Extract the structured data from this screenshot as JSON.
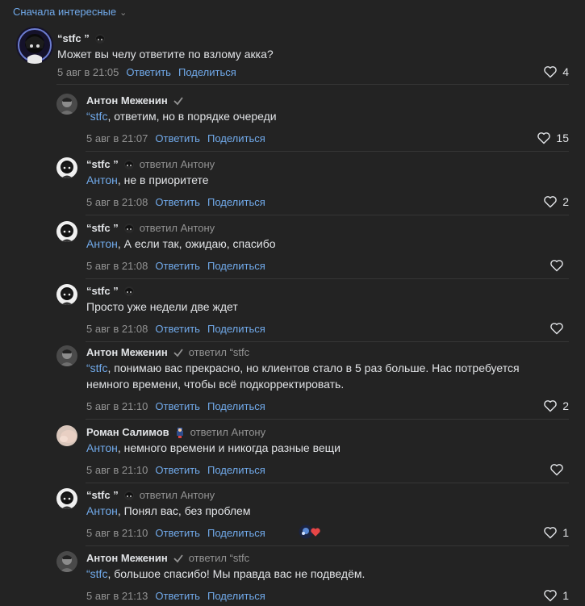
{
  "sort": {
    "label": "Сначала интересные"
  },
  "actions": {
    "reply": "Ответить",
    "share": "Поделиться"
  },
  "comments": [
    {
      "author": "“stfc ”",
      "reply_to": "",
      "mention": "",
      "text": "Может вы челу ответите по взлому акка?",
      "date": "5 авг в 21:05",
      "likes": "4"
    },
    {
      "author": "Антон Меженин",
      "reply_to": "",
      "mention": "“stfc",
      "text": ", ответим, но в порядке очереди",
      "date": "5 авг в 21:07",
      "likes": "15"
    },
    {
      "author": "“stfc ”",
      "reply_to": "ответил Антону",
      "mention": "Антон",
      "text": ", не в приоритете",
      "date": "5 авг в 21:08",
      "likes": "2"
    },
    {
      "author": "“stfc ”",
      "reply_to": "ответил Антону",
      "mention": "Антон",
      "text": ", А если так, ожидаю, спасибо",
      "date": "5 авг в 21:08",
      "likes": ""
    },
    {
      "author": "“stfc ”",
      "reply_to": "",
      "mention": "",
      "text": "Просто уже недели две ждет",
      "date": "5 авг в 21:08",
      "likes": ""
    },
    {
      "author": "Антон Меженин",
      "reply_to": "ответил “stfc",
      "mention": "“stfc",
      "text": ", понимаю вас прекрасно, но клиентов стало в 5 раз больше. Нас потребуется немного времени, чтобы всё подкорректировать.",
      "date": "5 авг в 21:10",
      "likes": "2"
    },
    {
      "author": "Роман Салимов",
      "reply_to": "ответил Антону",
      "mention": "Антон",
      "text": ", немного времени и никогда разные вещи",
      "date": "5 авг в 21:10",
      "likes": ""
    },
    {
      "author": "“stfc ”",
      "reply_to": "ответил Антону",
      "mention": "Антон",
      "text": ", Понял вас, без проблем",
      "date": "5 авг в 21:10",
      "likes": "1"
    },
    {
      "author": "Антон Меженин",
      "reply_to": "ответил “stfc",
      "mention": "“stfc",
      "text": ", большое спасибо! Мы правда вас не подведём.",
      "date": "5 авг в 21:13",
      "likes": "1"
    }
  ],
  "colors": {
    "bg": "#232323",
    "link": "#71aaeb",
    "muted": "#939393",
    "text": "#e1e3e6"
  }
}
